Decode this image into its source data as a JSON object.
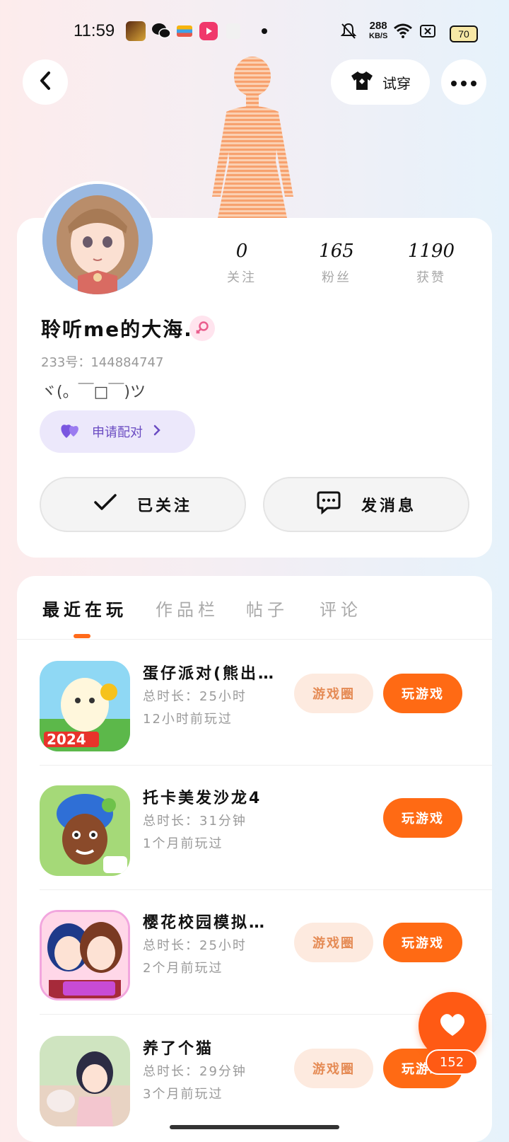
{
  "status_bar": {
    "time": "11:59",
    "net_speed_value": "288",
    "net_speed_unit": "KB/S",
    "battery": "70"
  },
  "nav": {
    "try_on_label": "试穿"
  },
  "profile": {
    "stats": [
      {
        "value": "0",
        "label": "关注"
      },
      {
        "value": "165",
        "label": "粉丝"
      },
      {
        "value": "1190",
        "label": "获赞"
      }
    ],
    "name": "聆听me的大海.",
    "uid": "233号：144884747",
    "bio": "ヾ(。￣□￣)ツ",
    "pair_label": "申请配对",
    "followed_label": "已关注",
    "message_label": "发消息"
  },
  "tabs": [
    "最近在玩",
    "作品栏",
    "帖子",
    "评论"
  ],
  "games": [
    {
      "title": "蛋仔派对(熊出…",
      "duration": "总时长：25小时",
      "last_played": "12小时前玩过",
      "circle_label": "游戏圈",
      "play_label": "玩游戏",
      "has_circle": true
    },
    {
      "title": "托卡美发沙龙4",
      "duration": "总时长：31分钟",
      "last_played": "1个月前玩过",
      "circle_label": "",
      "play_label": "玩游戏",
      "has_circle": false
    },
    {
      "title": "樱花校园模拟…",
      "duration": "总时长：25小时",
      "last_played": "2个月前玩过",
      "circle_label": "游戏圈",
      "play_label": "玩游戏",
      "has_circle": true
    },
    {
      "title": "养了个猫",
      "duration": "总时长：29分钟",
      "last_played": "3个月前玩过",
      "circle_label": "游戏圈",
      "play_label": "玩游戏",
      "has_circle": true
    }
  ],
  "like": {
    "count": "152"
  },
  "colors": {
    "accent": "#ff6a14",
    "pair_bg": "#ece8fb",
    "pair_text": "#6a4bc2"
  }
}
